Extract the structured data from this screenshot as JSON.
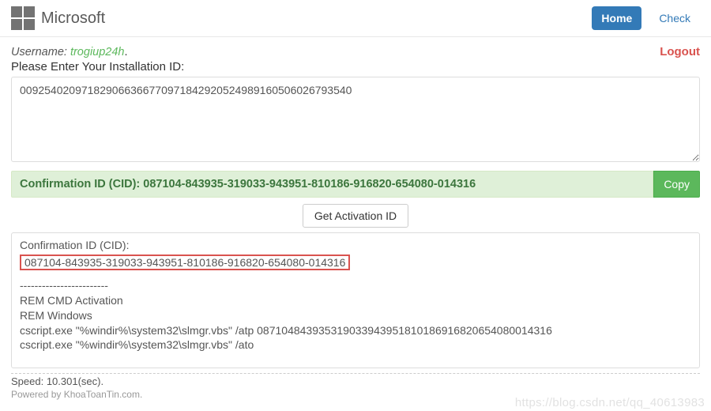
{
  "navbar": {
    "brand": "Microsoft",
    "home": "Home",
    "check": "Check"
  },
  "user": {
    "label": "Username: ",
    "name": "trogiup24h",
    "suffix": "."
  },
  "logout": "Logout",
  "prompt": "Please Enter Your Installation ID:",
  "iid_value": "009254020971829066366770971842920524989160506026793540",
  "cid_bar": {
    "label": "Confirmation ID (CID): ",
    "cid": "087104-843935-319033-943951-810186-916820-654080-014316",
    "copy": "Copy"
  },
  "get_btn": "Get Activation ID",
  "result": {
    "label": "Confirmation ID (CID):",
    "cid": "087104-843935-319033-943951-810186-916820-654080-014316",
    "sep": "------------------------",
    "rem1": "REM CMD Activation",
    "rem2": "REM Windows",
    "cmd1": "cscript.exe \"%windir%\\system32\\slmgr.vbs\" /atp 087104843935319033943951810186916820654080014316",
    "cmd2": "cscript.exe \"%windir%\\system32\\slmgr.vbs\" /ato"
  },
  "speed": "Speed: 10.301(sec).",
  "powered": "Powered by KhoaToanTin.com.",
  "watermark": "https://blog.csdn.net/qq_40613983"
}
